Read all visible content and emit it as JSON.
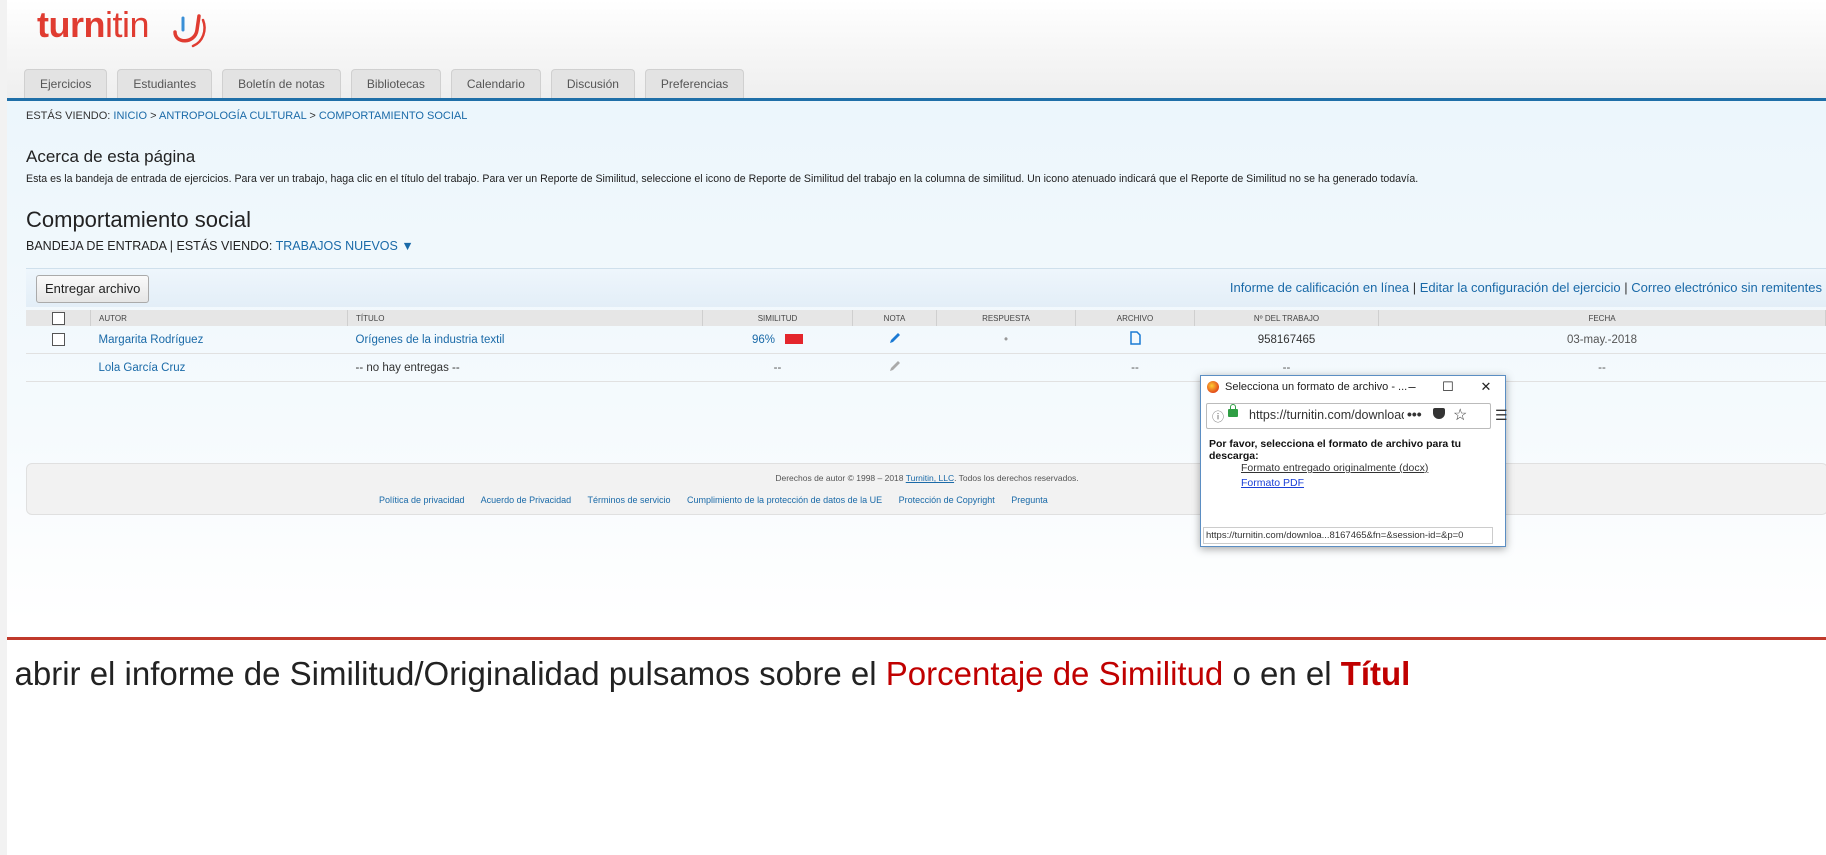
{
  "header": {
    "logo_text_1": "turn",
    "logo_text_2": "itin",
    "tabs": [
      "Ejercicios",
      "Estudiantes",
      "Boletín de notas",
      "Bibliotecas",
      "Calendario",
      "Discusión",
      "Preferencias"
    ]
  },
  "breadcrumb": {
    "prefix": "ESTÁS VIENDO: ",
    "home": "INICIO",
    "sep": " > ",
    "course": "ANTROPOLOGÍA CULTURAL",
    "current": "COMPORTAMIENTO SOCIAL"
  },
  "about": {
    "title": "Acerca de esta página",
    "text": "Esta es la bandeja de entrada de ejercicios. Para ver un trabajo, haga clic en el título del trabajo. Para ver un Reporte de Similitud, seleccione el icono de Reporte de Similitud del trabajo en la columna de similitud. Un icono atenuado indicará que el Reporte de Similitud no se ha generado todavía."
  },
  "assignment": {
    "title": "Comportamiento social",
    "inbox_label": "BANDEJA DE ENTRADA  | ESTÁS VIENDO: ",
    "view_option": "TRABAJOS NUEVOS ▼"
  },
  "actions": {
    "submit_label": "Entregar archivo",
    "link1": "Informe de calificación en línea",
    "link2": "Editar la configuración del ejercicio",
    "link3": "Correo electrónico sin remitentes",
    "sep": " | "
  },
  "table": {
    "columns": [
      "AUTOR",
      "TÍTULO",
      "SIMILITUD",
      "NOTA",
      "RESPUESTA",
      "ARCHIVO",
      "Nº DEL TRABAJO",
      "FECHA"
    ],
    "rows": [
      {
        "author": "Margarita Rodríguez",
        "title": "Orígenes de la industria textil",
        "similarity": "96%",
        "response": "•",
        "paper_id": "958167465",
        "date": "03-may.-2018"
      },
      {
        "author": "Lola García Cruz",
        "title": "-- no hay entregas --",
        "similarity": "--",
        "response": "",
        "file": "--",
        "paper_id": "--",
        "date": "--"
      }
    ],
    "similarity_color": "#e4262c"
  },
  "footer": {
    "copyright_pre": "Derechos de autor © 1998 – 2018 ",
    "copyright_link": "Turnitin, LLC",
    "copyright_post": ". Todos los derechos reservados.",
    "links": [
      "Política de privacidad",
      "Acuerdo de Privacidad",
      "Términos de servicio",
      "Cumplimiento de la protección de datos de la UE",
      "Protección de Copyright",
      "Pregunta"
    ]
  },
  "popup": {
    "title": "Selecciona un formato de archivo - ...",
    "url": "https://turnitin.com/download",
    "prompt": "Por favor, selecciona el formato de archivo para tu descarga:",
    "option1": "Formato entregado originalmente (docx)",
    "option2": "Formato PDF",
    "status": "https://turnitin.com/downloa...8167465&fn=&session-id=&p=0"
  },
  "caption": {
    "part1": "a abrir el informe de Similitud/Originalidad pulsamos sobre el ",
    "part2": "Porcentaje de Similitud",
    "part3": "  o en el ",
    "part4": "Títul"
  }
}
